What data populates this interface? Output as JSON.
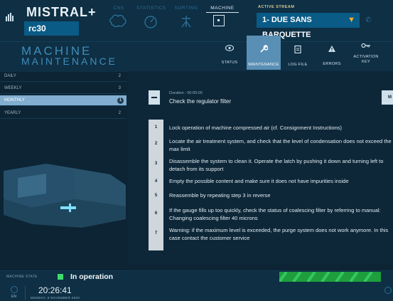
{
  "header": {
    "brand": "MISTRAL",
    "brand_symbol": "+",
    "machine_id": "rc30",
    "nav": [
      {
        "label": "CNS",
        "icon": "brain-icon"
      },
      {
        "label": "STATISTICS",
        "icon": "gauge-icon"
      },
      {
        "label": "SORTING",
        "icon": "sorting-icon"
      },
      {
        "label": "MACHINE",
        "icon": "machine-icon"
      }
    ],
    "active_stream_label": "ACTIVE STREAM",
    "active_stream_value": "1- DUE SANS BARQUETTE",
    "colors": {
      "accent": "#0a5b86",
      "warning": "#f0b228",
      "status_ok": "#3ddc6d"
    }
  },
  "page": {
    "title_line1": "MACHINE",
    "title_line2": "MAINTENANCE",
    "tabs": [
      {
        "label": "STATUS",
        "icon": "eye-icon"
      },
      {
        "label": "MAINTENANCE",
        "icon": "wrench-icon"
      },
      {
        "label": "LOG FILE",
        "icon": "clipboard-icon"
      },
      {
        "label": "ERRORS",
        "icon": "warning-icon"
      },
      {
        "label": "ACTIVATION KEY",
        "icon": "key-icon"
      }
    ]
  },
  "schedule": [
    {
      "label": "DAILY",
      "count": "2"
    },
    {
      "label": "WEEKLY",
      "count": "3"
    },
    {
      "label": "MONTHLY",
      "count": "1"
    },
    {
      "label": "YEARLY",
      "count": "2"
    }
  ],
  "task": {
    "duration": "Duration : 00:05:00",
    "title": "Check the regulator filter",
    "tag": "M"
  },
  "steps": [
    {
      "n": "1",
      "text": "Lock operation of machine compressed air (cf. Consignment Instructions)"
    },
    {
      "n": "2",
      "text": "Locate the air treatment system, and check that the level of condensation does not exceed the max limit"
    },
    {
      "n": "3",
      "text": "Disassemble the system to clean it. Operate the latch by pushing it down and turning left to detach from its support"
    },
    {
      "n": "4",
      "text": "Empty the possible content and make sure it does not have impurities inside"
    },
    {
      "n": "5",
      "text": "Reassemble by repeating step 3 in reverse"
    },
    {
      "n": "6",
      "text": "If the gauge fills up too quickly, check the status of coalescing filter by referring to manual: Changing coalescing filter 40 microns"
    },
    {
      "n": "7",
      "text": "Warning: if the maximum level is exceeded, the purge system does not work anymore. In this case contact the customer service"
    }
  ],
  "status": {
    "label": "MACHINE STATE",
    "value": "In operation"
  },
  "footer": {
    "lang": "EN",
    "time": "20:26:41",
    "date": "MONDAY, 9 NOVEMBER 2020"
  }
}
